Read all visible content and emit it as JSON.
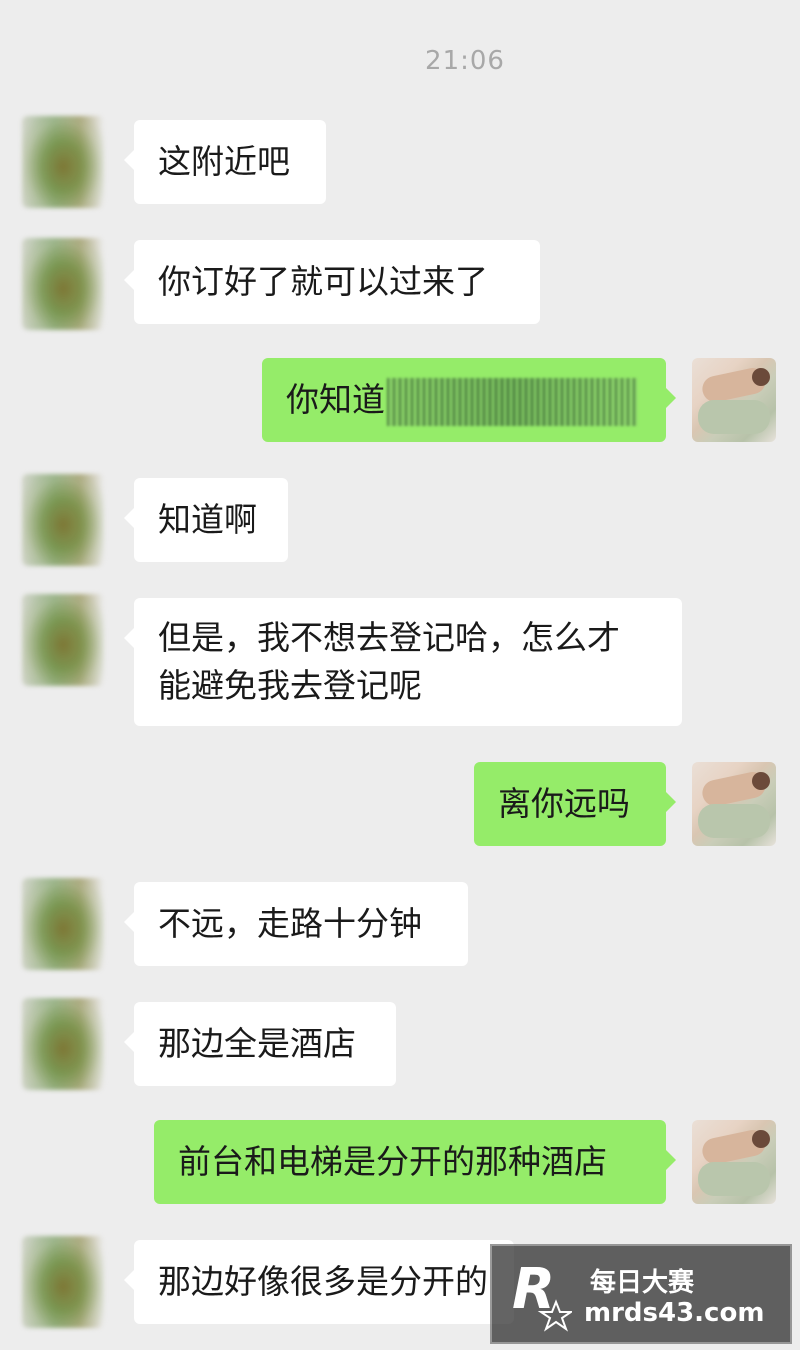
{
  "timestamp": "21:06",
  "messages": [
    {
      "side": "in",
      "text": "这附近吧"
    },
    {
      "side": "in",
      "text": "你订好了就可以过来了"
    },
    {
      "side": "out",
      "text": "你知道"
    },
    {
      "side": "in",
      "text": "知道啊"
    },
    {
      "side": "in",
      "line1": "但是，我不想去登记哈，怎么才",
      "line2": "能避免我去登记呢"
    },
    {
      "side": "out",
      "text": "离你远吗"
    },
    {
      "side": "in",
      "text": "不远，走路十分钟"
    },
    {
      "side": "in",
      "text": "那边全是酒店"
    },
    {
      "side": "out",
      "text": "前台和电梯是分开的那种酒店"
    },
    {
      "side": "in",
      "text": "那边好像很多是分开的"
    }
  ],
  "watermark": {
    "title": "每日大赛",
    "url": "mrds43.com",
    "logo_letter": "R",
    "logo_sub": "每日大赛"
  },
  "colors": {
    "background": "#ededed",
    "incoming_bubble": "#ffffff",
    "outgoing_bubble": "#95ec69",
    "timestamp": "#a8a8a8"
  },
  "icons": {
    "contact_avatar": "blurred-contact-avatar",
    "self_avatar": "self-avatar-photo",
    "watermark_logo": "r-star-logo"
  }
}
